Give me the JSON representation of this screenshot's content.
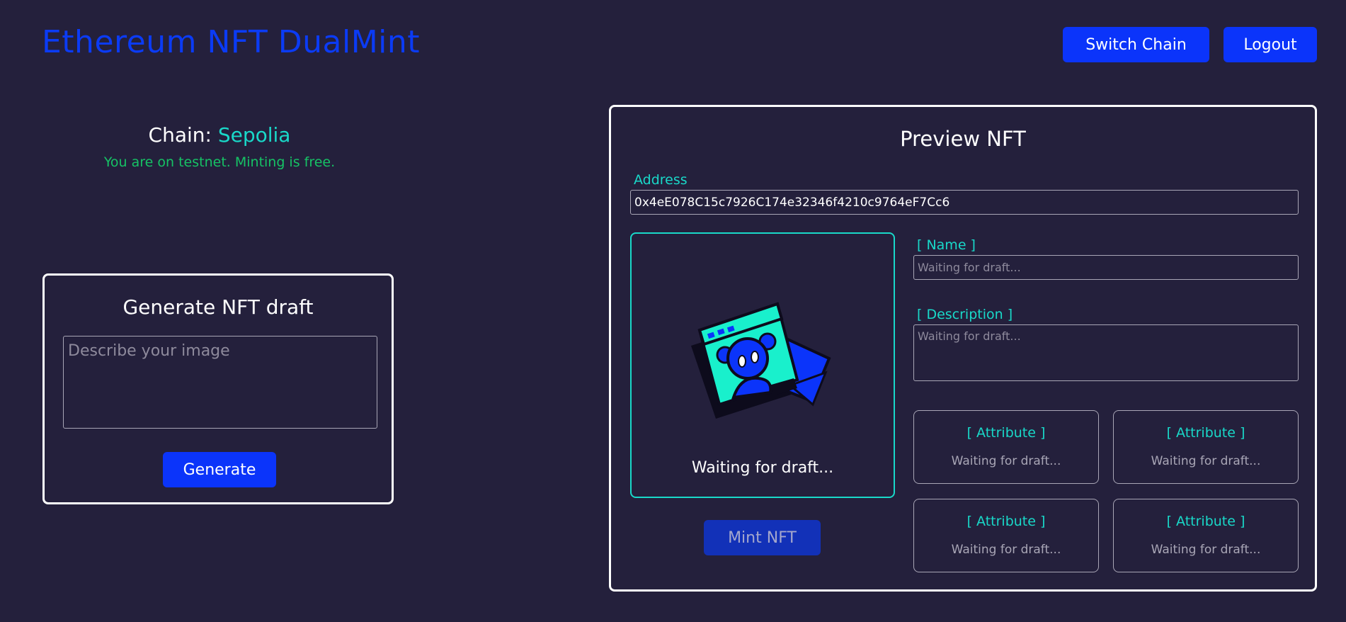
{
  "header": {
    "title": "Ethereum NFT DualMint",
    "switch_chain_label": "Switch Chain",
    "logout_label": "Logout"
  },
  "chain": {
    "prefix": "Chain:",
    "name": "Sepolia",
    "note": "You are on testnet. Minting is free."
  },
  "generator": {
    "title": "Generate NFT draft",
    "placeholder": "Describe your image",
    "button_label": "Generate"
  },
  "preview": {
    "title": "Preview NFT",
    "address_label": "Address",
    "address_value": "0x4eE078C15c7926C174e32346f4210c9764eF7Cc6",
    "image_caption": "Waiting for draft...",
    "mint_label": "Mint NFT",
    "name_label": "[ Name ]",
    "name_placeholder": "Waiting for draft...",
    "description_label": "[ Description ]",
    "description_placeholder": "Waiting for draft...",
    "attributes": [
      {
        "label": "[ Attribute ]",
        "value": "Waiting for draft..."
      },
      {
        "label": "[ Attribute ]",
        "value": "Waiting for draft..."
      },
      {
        "label": "[ Attribute ]",
        "value": "Waiting for draft..."
      },
      {
        "label": "[ Attribute ]",
        "value": "Waiting for draft..."
      }
    ]
  },
  "colors": {
    "background": "#24203c",
    "accent_blue": "#0b34fa",
    "accent_cyan": "#19d9c9",
    "testnet_green": "#16c265"
  },
  "icons": {
    "illustration": "nft-placeholder-illustration"
  }
}
